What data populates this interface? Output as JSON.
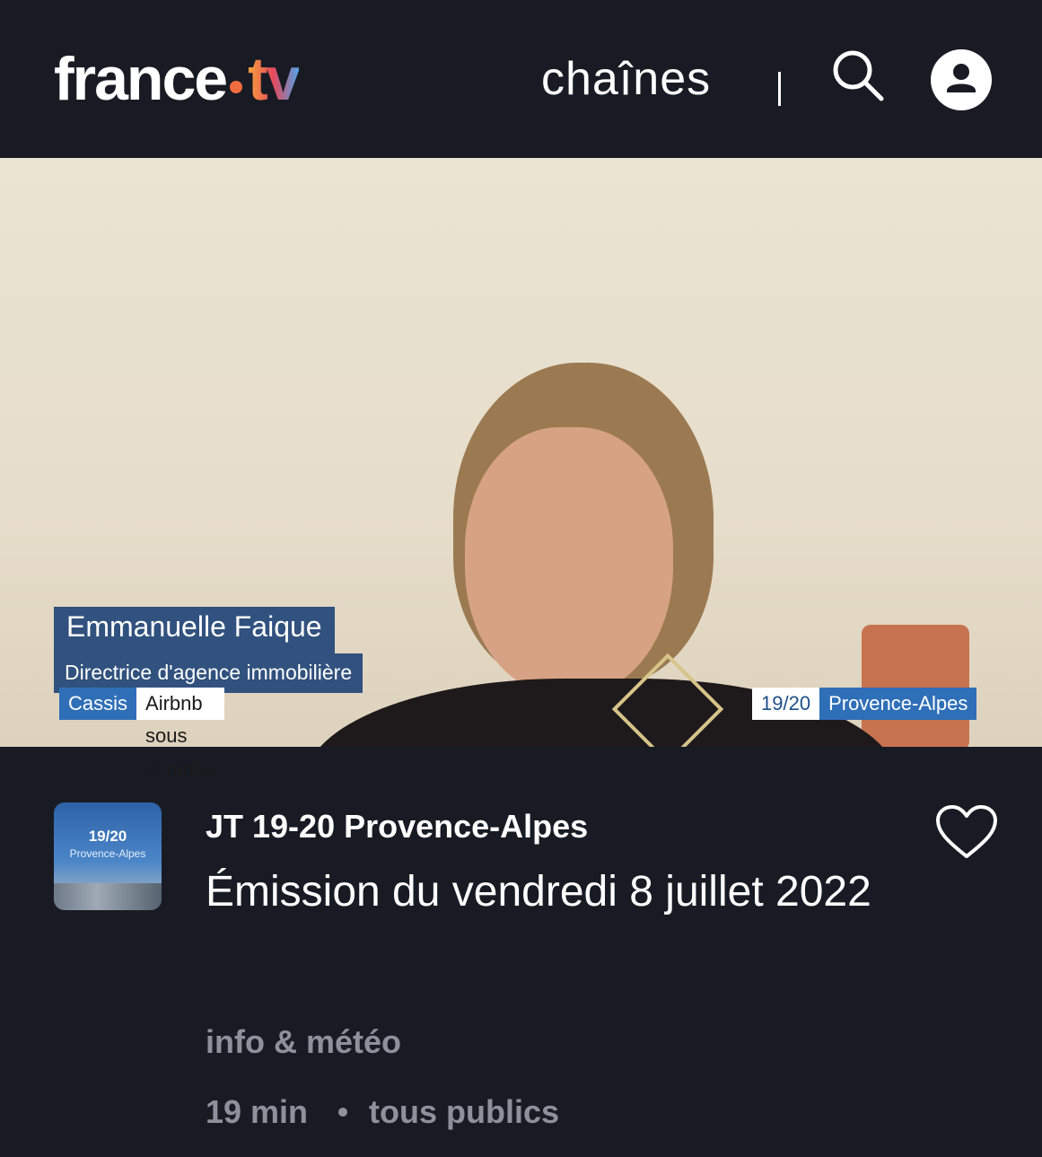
{
  "header": {
    "logo_main": "france",
    "logo_tv": "tv",
    "nav_channels": "chaînes",
    "icons": [
      "search-icon",
      "account-icon"
    ]
  },
  "video": {
    "lower_third": {
      "name": "Emmanuelle Faique",
      "role": "Directrice d'agence immobilière",
      "place": "Cassis",
      "topic": "Airbnb sous contrôle"
    },
    "badge": {
      "show": "19/20",
      "region": "Provence-Alpes"
    }
  },
  "program": {
    "thumbnail": {
      "title": "19/20",
      "subtitle": "Provence-Alpes"
    },
    "show_title": "JT 19-20 Provence-Alpes",
    "episode_title": "Émission du vendredi 8 juillet 2022",
    "category": "info & météo",
    "duration": "19 min",
    "audience": "tous publics",
    "favorite_icon": "heart-icon"
  },
  "colors": {
    "background": "#191b24",
    "text_primary": "#ffffff",
    "text_secondary": "#8e919b",
    "accent_blue": "#2f6fb7"
  }
}
